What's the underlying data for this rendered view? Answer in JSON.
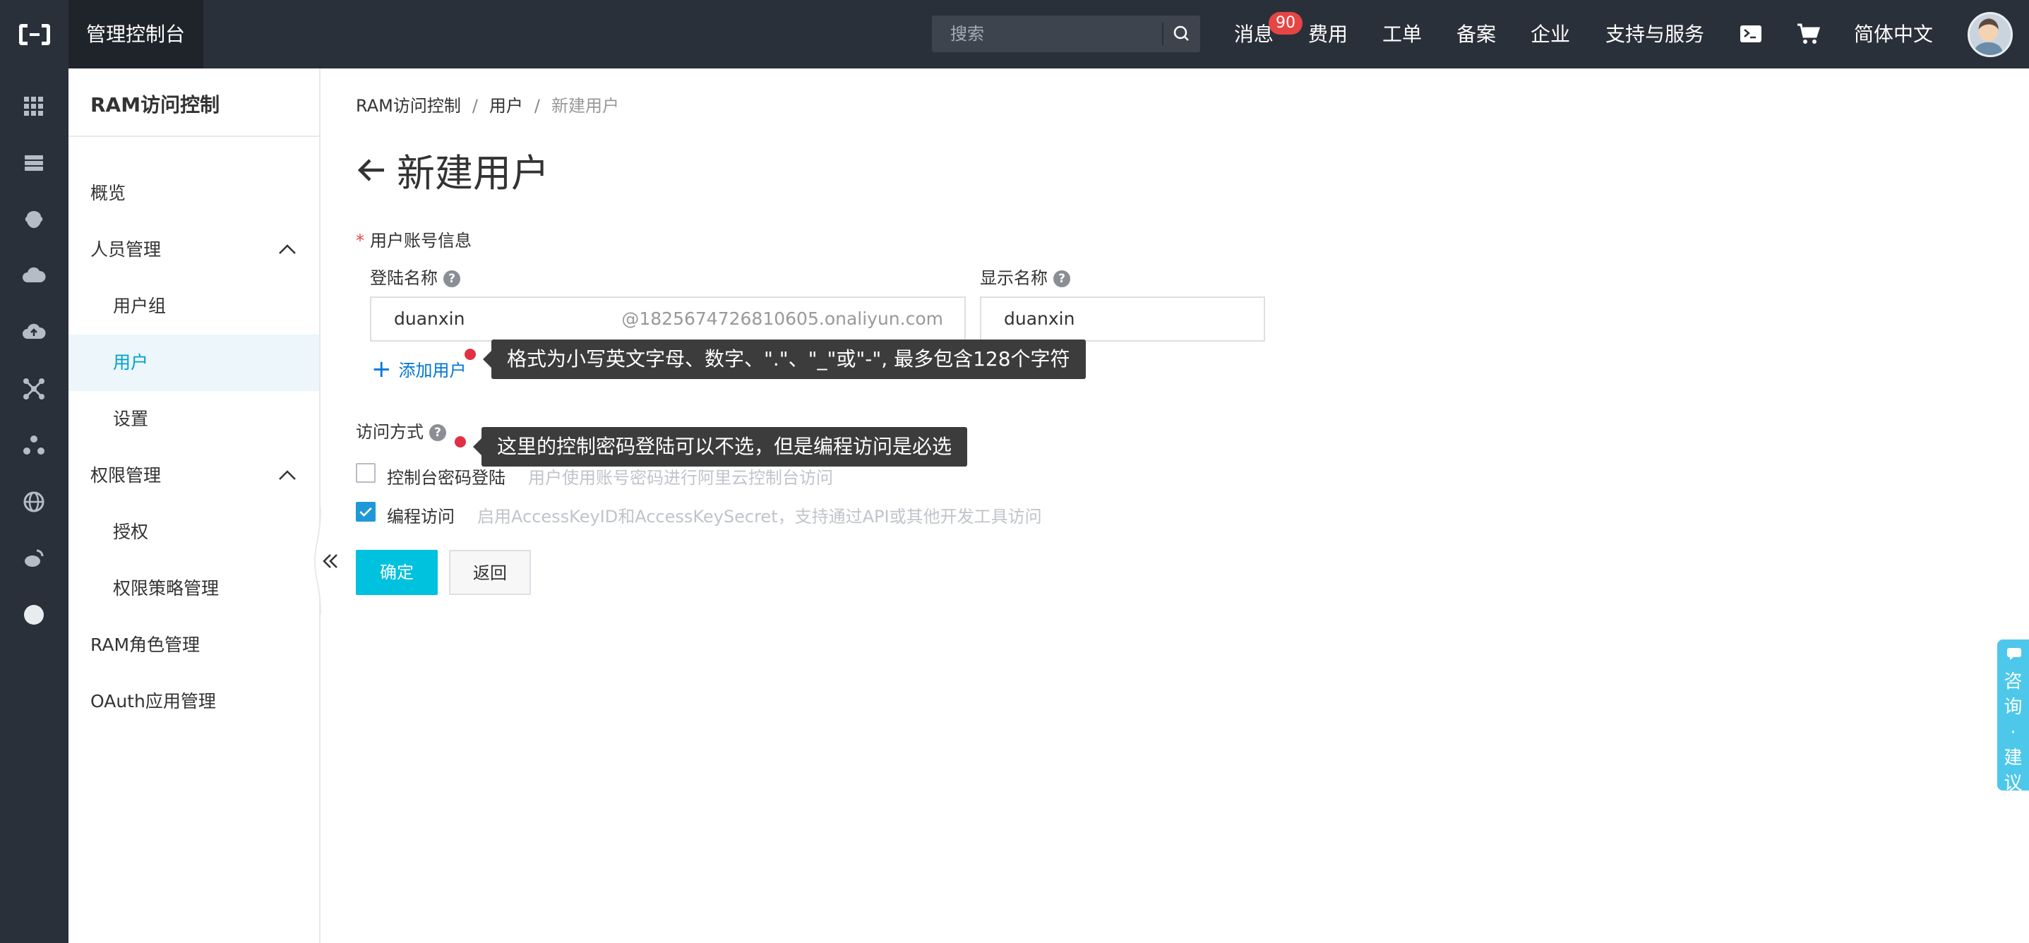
{
  "topbar": {
    "console_title": "管理控制台",
    "search_placeholder": "搜索",
    "nav": {
      "messages": "消息",
      "messages_badge": "90",
      "billing": "费用",
      "tickets": "工单",
      "icp": "备案",
      "enterprise": "企业",
      "support": "支持与服务",
      "language": "简体中文"
    }
  },
  "sidebar": {
    "title": "RAM访问控制",
    "items": [
      {
        "label": "概览"
      },
      {
        "label": "人员管理"
      },
      {
        "label": "用户组"
      },
      {
        "label": "用户"
      },
      {
        "label": "设置"
      },
      {
        "label": "权限管理"
      },
      {
        "label": "授权"
      },
      {
        "label": "权限策略管理"
      },
      {
        "label": "RAM角色管理"
      },
      {
        "label": "OAuth应用管理"
      }
    ]
  },
  "breadcrumb": {
    "root": "RAM访问控制",
    "sep": "/",
    "users": "用户",
    "current": "新建用户"
  },
  "page": {
    "title": "新建用户",
    "account_section": "用户账号信息",
    "required_mark": "*",
    "login_name_label": "登陆名称",
    "login_name_value": "duanxin",
    "login_name_suffix": "@1825674726810605.onaliyun.com",
    "display_name_label": "显示名称",
    "display_name_value": "duanxin",
    "help_glyph": "?",
    "add_user": "添加用户",
    "add_plus": "+",
    "tip_format": "格式为小写英文字母、数字、\".\"、\"_\"或\"-\", 最多包含128个字符",
    "access_label": "访问方式",
    "tip_access": "这里的控制密码登陆可以不选，但是编程访问是必选",
    "console_login_label": "控制台密码登陆",
    "console_login_hint": "用户使用账号密码进行阿里云控制台访问",
    "console_login_checked": false,
    "programmatic_label": "编程访问",
    "programmatic_hint": "启用AccessKeyID和AccessKeySecret，支持通过API或其他开发工具访问",
    "programmatic_checked": true,
    "ok_button": "确定",
    "back_button": "返回"
  },
  "float_widget": {
    "label": "咨询·建议"
  },
  "colors": {
    "topbar": "#2a3039",
    "primary": "#00c1de",
    "active_bg": "#ecf6fb",
    "link": "#0077d9",
    "badge": "#e64546"
  }
}
